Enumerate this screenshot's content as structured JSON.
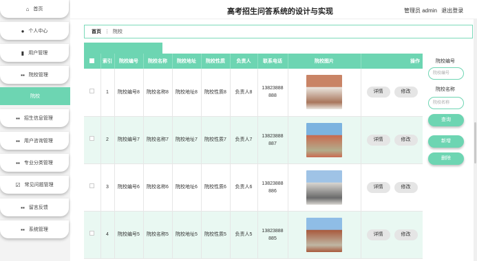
{
  "header": {
    "title": "高考招生问答系统的设计与实现",
    "user_label": "管理员 admin",
    "logout_label": "退出登录"
  },
  "sidebar": {
    "items": [
      {
        "label": "首页",
        "icon": "home-icon",
        "glyph": "⌂"
      },
      {
        "label": "个人中心",
        "icon": "person-icon",
        "glyph": "●"
      },
      {
        "label": "用户管理",
        "icon": "doc-icon",
        "glyph": "▮"
      },
      {
        "label": "院校管理",
        "icon": "grid-icon",
        "glyph": "▪▪"
      },
      {
        "label": "院校",
        "icon": "",
        "glyph": "",
        "active": true
      },
      {
        "label": "招生信息管理",
        "icon": "grid-icon",
        "glyph": "▪▪"
      },
      {
        "label": "用户咨询管理",
        "icon": "grid-icon",
        "glyph": "▪▪"
      },
      {
        "label": "专业分类管理",
        "icon": "grid-icon",
        "glyph": "▪▪"
      },
      {
        "label": "常见问题管理",
        "icon": "checkbox-icon",
        "glyph": "☑"
      },
      {
        "label": "留言反馈",
        "icon": "grid-icon",
        "glyph": "▪▪"
      },
      {
        "label": "系统管理",
        "icon": "grid-icon",
        "glyph": "▪▪"
      }
    ]
  },
  "breadcrumb": {
    "home": "首页",
    "sep": "⋮",
    "current": "院校"
  },
  "table": {
    "headers": [
      "索引",
      "院校编号",
      "院校名称",
      "院校地址",
      "院校性质",
      "负责人",
      "联系电话",
      "院校图片",
      "操作"
    ],
    "rows": [
      {
        "index": "1",
        "code": "院校编号8",
        "name": "院校名称8",
        "addr": "院校地址8",
        "nature": "院校性质8",
        "owner": "负责人8",
        "phone": "13823888888"
      },
      {
        "index": "2",
        "code": "院校编号7",
        "name": "院校名称7",
        "addr": "院校地址7",
        "nature": "院校性质7",
        "owner": "负责人7",
        "phone": "13823888887"
      },
      {
        "index": "3",
        "code": "院校编号6",
        "name": "院校名称6",
        "addr": "院校地址6",
        "nature": "院校性质6",
        "owner": "负责人6",
        "phone": "13823888886"
      },
      {
        "index": "4",
        "code": "院校编号5",
        "name": "院校名称5",
        "addr": "院校地址5",
        "nature": "院校性质5",
        "owner": "负责人5",
        "phone": "13823888885"
      }
    ],
    "detail_label": "详情",
    "edit_label": "修改"
  },
  "search": {
    "code_label": "院校编号",
    "code_placeholder": "院校编号",
    "name_label": "院校名称",
    "name_placeholder": "院校名称",
    "query_label": "查询",
    "add_label": "新增",
    "delete_label": "删除"
  },
  "colors": {
    "accent": "#6dd5b2",
    "row_alt": "#e9f8f2"
  }
}
